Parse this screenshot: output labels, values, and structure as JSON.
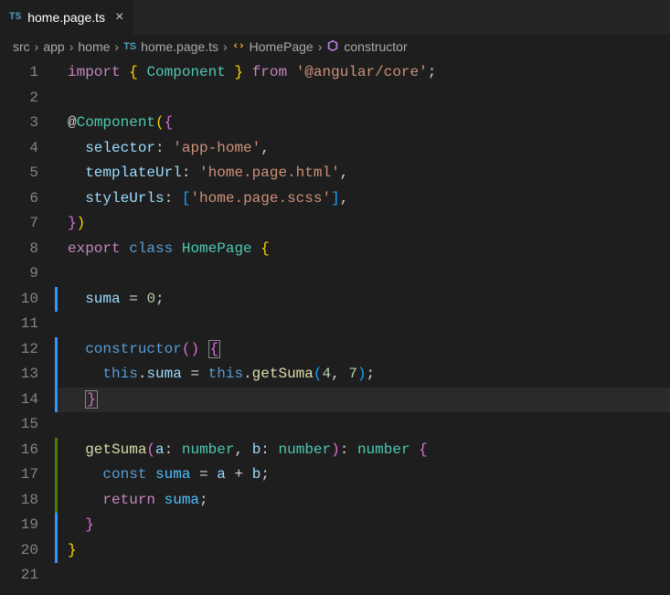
{
  "tab": {
    "icon_label": "TS",
    "filename": "home.page.ts",
    "close_glyph": "×"
  },
  "breadcrumbs": {
    "sep": "›",
    "items": [
      {
        "label": "src"
      },
      {
        "label": "app"
      },
      {
        "label": "home"
      },
      {
        "label": "home.page.ts",
        "icon": "TS"
      },
      {
        "label": "HomePage",
        "icon": "class"
      },
      {
        "label": "constructor",
        "icon": "method"
      }
    ]
  },
  "gutter": {
    "lines": [
      "1",
      "2",
      "3",
      "4",
      "5",
      "6",
      "7",
      "8",
      "9",
      "10",
      "11",
      "12",
      "13",
      "14",
      "15",
      "16",
      "17",
      "18",
      "19",
      "20",
      "21"
    ]
  },
  "markers": {
    "blue_lines": [
      10,
      12,
      13,
      14,
      19,
      20
    ],
    "green_lines": [
      16,
      17,
      18
    ]
  },
  "code": {
    "l1": {
      "import": "import",
      "comp": "Component",
      "from": "from",
      "str": "'@angular/core'"
    },
    "l3": {
      "at": "@",
      "dec": "Component"
    },
    "l4": {
      "prop": "selector",
      "str": "'app-home'"
    },
    "l5": {
      "prop": "templateUrl",
      "str": "'home.page.html'"
    },
    "l6": {
      "prop": "styleUrls",
      "str": "'home.page.scss'"
    },
    "l8": {
      "export": "export",
      "class": "class",
      "name": "HomePage"
    },
    "l10": {
      "prop": "suma",
      "val": "0"
    },
    "l12": {
      "ctor": "constructor"
    },
    "l13": {
      "this1": "this",
      "prop": "suma",
      "this2": "this",
      "fn": "getSuma",
      "a": "4",
      "b": "7"
    },
    "l16": {
      "fn": "getSuma",
      "a": "a",
      "at": "number",
      "b": "b",
      "bt": "number",
      "rt": "number"
    },
    "l17": {
      "const": "const",
      "name": "suma",
      "a": "a",
      "b": "b"
    },
    "l18": {
      "ret": "return",
      "name": "suma"
    }
  }
}
